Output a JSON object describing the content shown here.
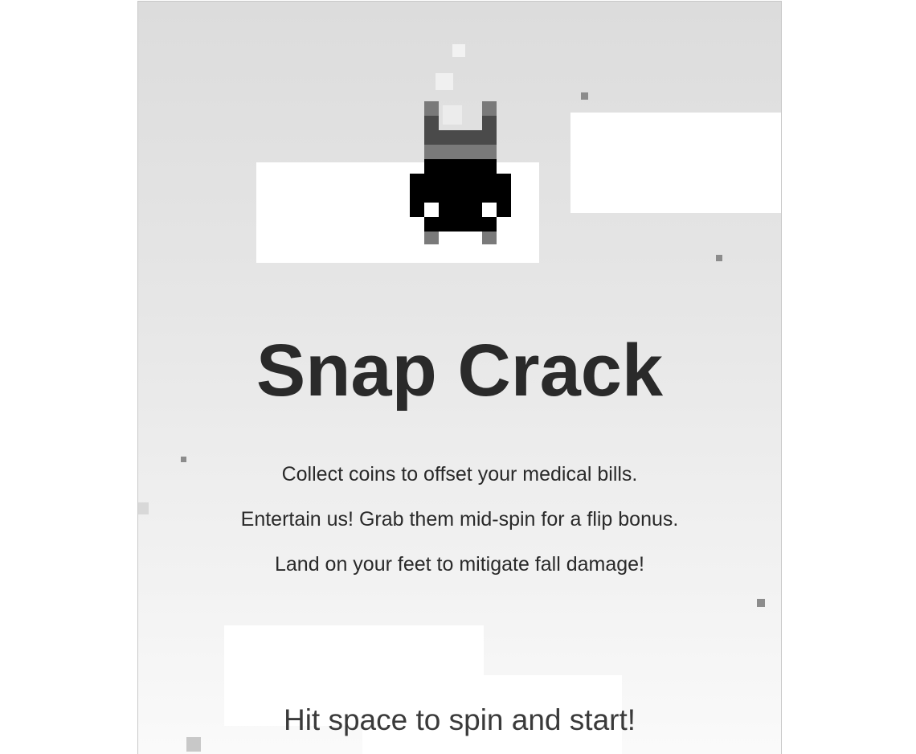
{
  "game": {
    "title": "Snap Crack",
    "instructions": [
      "Collect coins to offset your medical bills.",
      "Entertain us! Grab them mid-spin for a flip bonus.",
      "Land on your feet to mitigate fall damage!"
    ],
    "start_prompt": "Hit space to spin and start!"
  },
  "colors": {
    "background_top": "#dcdcdc",
    "background_bottom": "#fafafa",
    "platform": "#ffffff",
    "text": "#2a2a2a",
    "player_body": "#000000",
    "player_shade_dark": "#4a4a4a",
    "player_shade_mid": "#7a7a7a",
    "particle": "#8c8c8c"
  },
  "player_sprite": "pixel-character-icon"
}
